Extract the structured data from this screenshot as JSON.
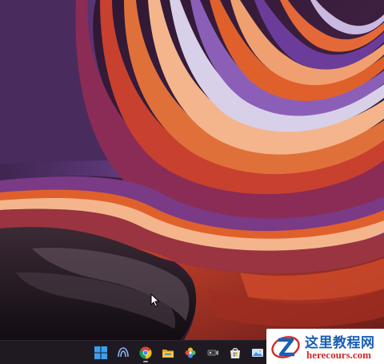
{
  "desktop": {
    "wallpaper": "windows-11-abstract-swirl-purple-orange",
    "colors": {
      "deep": "#1a0f1c",
      "purple": "#5e3a78",
      "violet": "#8b5fb8",
      "magenta": "#8a2c56",
      "orange": "#e0602c",
      "red": "#b8321e",
      "peach": "#f4b58c"
    }
  },
  "taskbar": {
    "background": "#1f1a22",
    "icons": [
      {
        "name": "start-icon",
        "active": false
      },
      {
        "name": "copilot-icon",
        "active": false
      },
      {
        "name": "chrome-icon",
        "active": true
      },
      {
        "name": "file-explorer-icon",
        "active": false
      },
      {
        "name": "photos-icon",
        "active": false
      },
      {
        "name": "media-player-icon",
        "active": false
      },
      {
        "name": "microsoft-store-icon",
        "active": false
      },
      {
        "name": "gallery-icon",
        "active": false
      }
    ]
  },
  "watermark": {
    "title": "这里教程网",
    "domain": "herecours.com"
  }
}
